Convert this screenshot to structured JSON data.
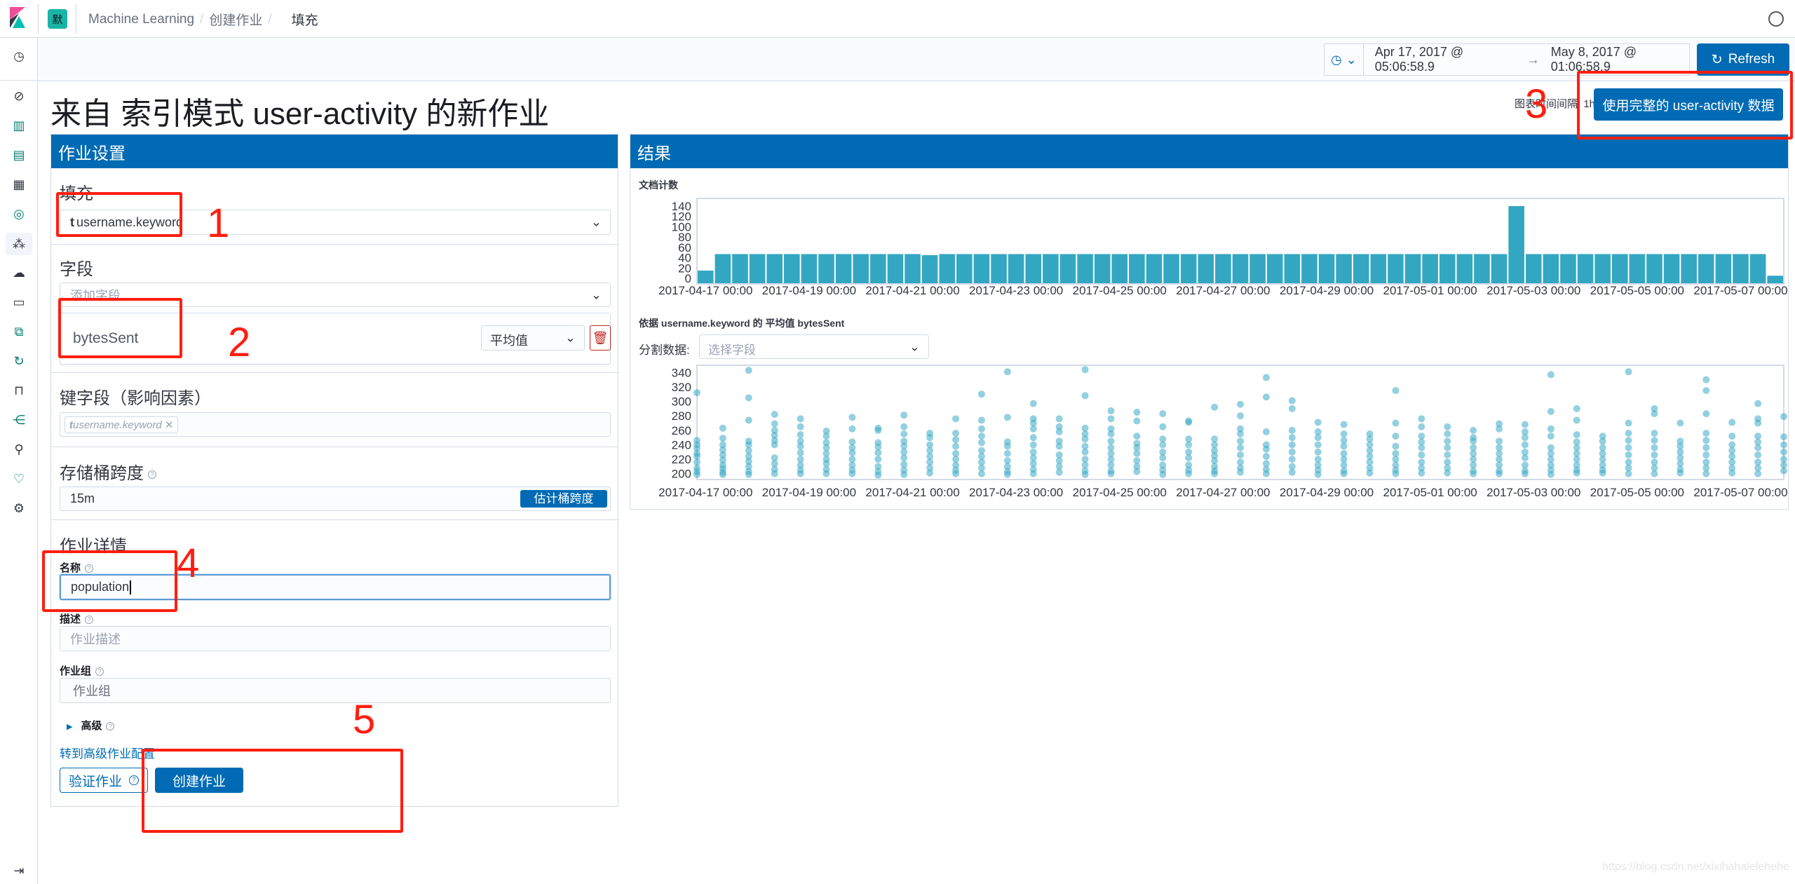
{
  "header": {
    "space_initial": "默",
    "breadcrumbs": [
      "Machine Learning",
      "创建作业",
      "填充"
    ]
  },
  "timebar": {
    "start": "Apr 17, 2017 @ 05:06:58.9",
    "arrow": "→",
    "end": "May 8, 2017 @ 01:06:58.9",
    "refresh_label": "Refresh"
  },
  "page": {
    "title": "来自 索引模式 user-activity 的新作业",
    "chart_interval": "图表时间间隔: 1h",
    "use_full_data_label": "使用完整的 user-activity 数据"
  },
  "settings": {
    "header": "作业设置",
    "population_heading": "填充",
    "population_field_type": "t",
    "population_field": "username.keyword",
    "fields_heading": "字段",
    "add_field_placeholder": "添加字段",
    "metric_field": "bytesSent",
    "agg_value": "平均值",
    "influencers_heading": "键字段（影响因素）",
    "influencer_type": "t",
    "influencer": "username.keyword",
    "influencer_remove": "✕",
    "bucket_span_heading": "存储桶跨度",
    "bucket_span_value": "15m",
    "estimate_label": "估计桶跨度",
    "job_details_heading": "作业详情",
    "name_label": "名称",
    "name_value": "population",
    "description_label": "描述",
    "description_placeholder": "作业描述",
    "group_label": "作业组",
    "group_placeholder": "作业组",
    "advanced_label": "高级",
    "advanced_link": "转到高级作业配置",
    "validate_label": "验证作业",
    "create_label": "创建作业"
  },
  "results": {
    "header": "结果",
    "split_label": "分割数据:",
    "split_placeholder": "选择字段"
  },
  "annotations": [
    "1",
    "2",
    "3",
    "4",
    "5"
  ],
  "watermark": "https://blog.csdn.net/xixihahalelehehe",
  "colors": {
    "primary": "#006BB4",
    "bar": "#33A7C2",
    "dot": "#3AAAC6",
    "annotation": "#FF1E10"
  },
  "chart_data": [
    {
      "type": "bar",
      "title": "文档计数",
      "xlim": [
        "2017-04-16 20:00",
        "2017-05-07 20:00"
      ],
      "ylim": [
        0,
        155
      ],
      "yticks": [
        0,
        20,
        40,
        60,
        80,
        100,
        120,
        140
      ],
      "xticks": [
        "2017-04-17 00:00",
        "2017-04-19 00:00",
        "2017-04-21 00:00",
        "2017-04-23 00:00",
        "2017-04-25 00:00",
        "2017-04-27 00:00",
        "2017-04-29 00:00",
        "2017-05-01 00:00",
        "2017-05-03 00:00",
        "2017-05-05 00:00",
        "2017-05-07 00:00"
      ],
      "x": [
        "2017-04-16 20:00",
        "2017-04-17 04:00",
        "2017-04-17 12:00",
        "2017-04-17 20:00",
        "2017-04-18 04:00",
        "2017-04-18 12:00",
        "2017-04-18 20:00",
        "2017-04-19 04:00",
        "2017-04-19 12:00",
        "2017-04-19 20:00",
        "2017-04-20 04:00",
        "2017-04-20 12:00",
        "2017-04-20 20:00",
        "2017-04-21 04:00",
        "2017-04-21 12:00",
        "2017-04-21 20:00",
        "2017-04-22 04:00",
        "2017-04-22 12:00",
        "2017-04-22 20:00",
        "2017-04-23 04:00",
        "2017-04-23 12:00",
        "2017-04-23 20:00",
        "2017-04-24 04:00",
        "2017-04-24 12:00",
        "2017-04-24 20:00",
        "2017-04-25 04:00",
        "2017-04-25 12:00",
        "2017-04-25 20:00",
        "2017-04-26 04:00",
        "2017-04-26 12:00",
        "2017-04-26 20:00",
        "2017-04-27 04:00",
        "2017-04-27 12:00",
        "2017-04-27 20:00",
        "2017-04-28 04:00",
        "2017-04-28 12:00",
        "2017-04-28 20:00",
        "2017-04-29 04:00",
        "2017-04-29 12:00",
        "2017-04-29 20:00",
        "2017-04-30 04:00",
        "2017-04-30 12:00",
        "2017-04-30 20:00",
        "2017-05-01 04:00",
        "2017-05-01 12:00",
        "2017-05-01 20:00",
        "2017-05-02 04:00",
        "2017-05-02 12:00",
        "2017-05-02 20:00",
        "2017-05-03 04:00",
        "2017-05-03 12:00",
        "2017-05-03 20:00",
        "2017-05-04 04:00",
        "2017-05-04 12:00",
        "2017-05-04 20:00",
        "2017-05-05 04:00",
        "2017-05-05 12:00",
        "2017-05-05 20:00",
        "2017-05-06 04:00",
        "2017-05-06 12:00",
        "2017-05-06 20:00",
        "2017-05-07 04:00",
        "2017-05-07 12:00"
      ],
      "values": [
        15,
        47,
        47,
        47,
        47,
        47,
        47,
        47,
        47,
        47,
        47,
        47,
        47,
        45,
        47,
        47,
        47,
        47,
        47,
        47,
        47,
        47,
        47,
        47,
        47,
        47,
        47,
        47,
        47,
        47,
        47,
        47,
        47,
        47,
        47,
        47,
        47,
        47,
        47,
        47,
        47,
        47,
        47,
        47,
        47,
        47,
        47,
        140,
        47,
        47,
        47,
        47,
        47,
        47,
        47,
        47,
        47,
        47,
        47,
        47,
        47,
        47,
        5
      ]
    },
    {
      "type": "scatter",
      "title": "依据 username.keyword 的 平均值 bytesSent",
      "xlim": [
        "2017-04-16 20:00",
        "2017-05-07 20:00"
      ],
      "ylim": [
        192,
        350
      ],
      "yticks": [
        200,
        220,
        240,
        260,
        280,
        300,
        320,
        340
      ],
      "xticks": [
        "2017-04-17 00:00",
        "2017-04-19 00:00",
        "2017-04-21 00:00",
        "2017-04-23 00:00",
        "2017-04-25 00:00",
        "2017-04-27 00:00",
        "2017-04-29 00:00",
        "2017-05-01 00:00",
        "2017-05-03 00:00",
        "2017-05-05 00:00",
        "2017-05-07 00:00"
      ],
      "columns": [
        {
          "x": "2017-04-16 20:00",
          "y": [
            312,
            246,
            240,
            235,
            228,
            224,
            216,
            208,
            203,
            199
          ]
        },
        {
          "x": "2017-04-17 08:00",
          "y": [
            263,
            249,
            240,
            233,
            226,
            219,
            212,
            207,
            202,
            199
          ]
        },
        {
          "x": "2017-04-17 20:00",
          "y": [
            343,
            305,
            274,
            245,
            240,
            232,
            224,
            217,
            210,
            203,
            199
          ]
        },
        {
          "x": "2017-04-18 08:00",
          "y": [
            282,
            269,
            260,
            253,
            246,
            240,
            222,
            214,
            206,
            200
          ]
        },
        {
          "x": "2017-04-18 20:00",
          "y": [
            276,
            265,
            254,
            245,
            238,
            229,
            220,
            212,
            205,
            200
          ]
        },
        {
          "x": "2017-04-19 08:00",
          "y": [
            259,
            252,
            243,
            236,
            228,
            220,
            214,
            206,
            200
          ]
        },
        {
          "x": "2017-04-19 20:00",
          "y": [
            278,
            262,
            244,
            236,
            229,
            220,
            212,
            205,
            200
          ]
        },
        {
          "x": "2017-04-20 08:00",
          "y": [
            263,
            260,
            243,
            237,
            229,
            220,
            210,
            203,
            198
          ]
        },
        {
          "x": "2017-04-20 20:00",
          "y": [
            281,
            265,
            255,
            245,
            238,
            230,
            222,
            213,
            205,
            199
          ]
        },
        {
          "x": "2017-04-21 08:00",
          "y": [
            256,
            250,
            240,
            232,
            224,
            216,
            208,
            201
          ]
        },
        {
          "x": "2017-04-21 20:00",
          "y": [
            276,
            256,
            247,
            238,
            228,
            220,
            212,
            205,
            200
          ]
        },
        {
          "x": "2017-04-22 08:00",
          "y": [
            310,
            274,
            262,
            252,
            243,
            232,
            224,
            216,
            208,
            200
          ]
        },
        {
          "x": "2017-04-22 20:00",
          "y": [
            341,
            278,
            244,
            238,
            228,
            218,
            210,
            203,
            199
          ]
        },
        {
          "x": "2017-04-23 08:00",
          "y": [
            297,
            276,
            270,
            262,
            250,
            240,
            230,
            222,
            214,
            206,
            200
          ]
        },
        {
          "x": "2017-04-23 20:00",
          "y": [
            276,
            265,
            258,
            245,
            238,
            226,
            218,
            210,
            202
          ]
        },
        {
          "x": "2017-04-24 08:00",
          "y": [
            344,
            308,
            263,
            255,
            248,
            238,
            230,
            220,
            212,
            204,
            199
          ]
        },
        {
          "x": "2017-04-24 20:00",
          "y": [
            287,
            276,
            262,
            255,
            245,
            236,
            228,
            220,
            212,
            204,
            200
          ]
        },
        {
          "x": "2017-04-25 08:00",
          "y": [
            285,
            273,
            252,
            242,
            236,
            228,
            218,
            210,
            203
          ]
        },
        {
          "x": "2017-04-25 20:00",
          "y": [
            283,
            265,
            248,
            240,
            230,
            222,
            212,
            205,
            199
          ]
        },
        {
          "x": "2017-04-26 08:00",
          "y": [
            273,
            271,
            248,
            240,
            230,
            222,
            212,
            205,
            200
          ]
        },
        {
          "x": "2017-04-26 20:00",
          "y": [
            292,
            248,
            240,
            232,
            225,
            218,
            210,
            204,
            200
          ]
        },
        {
          "x": "2017-04-27 08:00",
          "y": [
            296,
            280,
            262,
            255,
            245,
            236,
            226,
            216,
            208,
            202
          ]
        },
        {
          "x": "2017-04-27 20:00",
          "y": [
            333,
            306,
            258,
            240,
            234,
            224,
            214,
            206,
            200
          ]
        },
        {
          "x": "2017-04-28 08:00",
          "y": [
            301,
            290,
            260,
            250,
            240,
            230,
            220,
            210,
            202
          ]
        },
        {
          "x": "2017-04-28 20:00",
          "y": [
            271,
            258,
            250,
            240,
            230,
            220,
            212,
            205,
            199
          ]
        },
        {
          "x": "2017-04-29 08:00",
          "y": [
            268,
            255,
            246,
            238,
            228,
            220,
            212,
            204,
            200
          ]
        },
        {
          "x": "2017-04-29 20:00",
          "y": [
            255,
            248,
            240,
            232,
            224,
            216,
            208,
            201
          ]
        },
        {
          "x": "2017-04-30 08:00",
          "y": [
            315,
            270,
            252,
            238,
            228,
            220,
            212,
            205,
            200
          ]
        },
        {
          "x": "2017-04-30 20:00",
          "y": [
            276,
            265,
            252,
            244,
            236,
            226,
            216,
            208,
            201
          ]
        },
        {
          "x": "2017-05-01 08:00",
          "y": [
            265,
            255,
            245,
            236,
            226,
            216,
            208,
            201
          ]
        },
        {
          "x": "2017-05-01 20:00",
          "y": [
            260,
            250,
            245,
            236,
            228,
            220,
            212,
            204,
            200
          ]
        },
        {
          "x": "2017-05-02 08:00",
          "y": [
            269,
            262,
            245,
            236,
            228,
            220,
            212,
            204,
            200
          ]
        },
        {
          "x": "2017-05-02 20:00",
          "y": [
            268,
            258,
            250,
            240,
            230,
            222,
            212,
            204,
            200
          ]
        },
        {
          "x": "2017-05-03 08:00",
          "y": [
            337,
            286,
            262,
            252,
            236,
            228,
            220,
            212,
            205,
            199
          ]
        },
        {
          "x": "2017-05-03 20:00",
          "y": [
            290,
            274,
            254,
            244,
            236,
            228,
            220,
            212,
            205,
            201
          ]
        },
        {
          "x": "2017-05-04 08:00",
          "y": [
            252,
            245,
            236,
            228,
            220,
            212,
            205,
            201
          ]
        },
        {
          "x": "2017-05-04 20:00",
          "y": [
            341,
            270,
            256,
            246,
            236,
            226,
            216,
            208,
            200
          ]
        },
        {
          "x": "2017-05-05 08:00",
          "y": [
            290,
            283,
            256,
            246,
            236,
            226,
            216,
            208,
            200
          ]
        },
        {
          "x": "2017-05-05 20:00",
          "y": [
            270,
            245,
            238,
            230,
            222,
            214,
            206,
            201
          ]
        },
        {
          "x": "2017-05-06 08:00",
          "y": [
            330,
            315,
            283,
            256,
            246,
            236,
            226,
            216,
            208,
            200
          ]
        },
        {
          "x": "2017-05-06 20:00",
          "y": [
            271,
            252,
            240,
            232,
            224,
            216,
            208,
            201
          ]
        },
        {
          "x": "2017-05-07 08:00",
          "y": [
            297,
            276,
            270,
            252,
            244,
            236,
            226,
            216,
            208,
            200
          ]
        },
        {
          "x": "2017-05-07 20:00",
          "y": [
            279,
            251,
            240,
            230,
            220,
            212,
            204
          ]
        }
      ]
    }
  ]
}
